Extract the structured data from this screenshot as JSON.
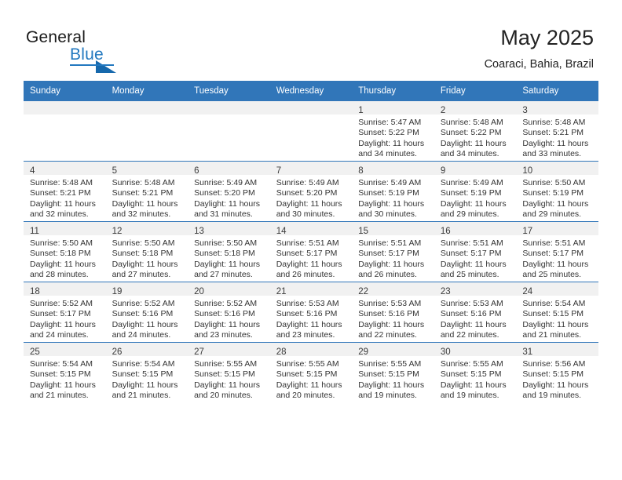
{
  "branding": {
    "name_part1": "General",
    "name_part2": "Blue",
    "accent_color": "#2278bf",
    "triangle_color": "#1668ac"
  },
  "header": {
    "title": "May 2025",
    "subtitle": "Coaraci, Bahia, Brazil"
  },
  "calendar": {
    "header_bg": "#3176b9",
    "daynum_bg": "#f1f1f1",
    "weekday_headers": [
      "Sunday",
      "Monday",
      "Tuesday",
      "Wednesday",
      "Thursday",
      "Friday",
      "Saturday"
    ],
    "weeks": [
      [
        {
          "day": "",
          "lines": []
        },
        {
          "day": "",
          "lines": []
        },
        {
          "day": "",
          "lines": []
        },
        {
          "day": "",
          "lines": []
        },
        {
          "day": "1",
          "lines": [
            "Sunrise: 5:47 AM",
            "Sunset: 5:22 PM",
            "Daylight: 11 hours",
            "and 34 minutes."
          ]
        },
        {
          "day": "2",
          "lines": [
            "Sunrise: 5:48 AM",
            "Sunset: 5:22 PM",
            "Daylight: 11 hours",
            "and 34 minutes."
          ]
        },
        {
          "day": "3",
          "lines": [
            "Sunrise: 5:48 AM",
            "Sunset: 5:21 PM",
            "Daylight: 11 hours",
            "and 33 minutes."
          ]
        }
      ],
      [
        {
          "day": "4",
          "lines": [
            "Sunrise: 5:48 AM",
            "Sunset: 5:21 PM",
            "Daylight: 11 hours",
            "and 32 minutes."
          ]
        },
        {
          "day": "5",
          "lines": [
            "Sunrise: 5:48 AM",
            "Sunset: 5:21 PM",
            "Daylight: 11 hours",
            "and 32 minutes."
          ]
        },
        {
          "day": "6",
          "lines": [
            "Sunrise: 5:49 AM",
            "Sunset: 5:20 PM",
            "Daylight: 11 hours",
            "and 31 minutes."
          ]
        },
        {
          "day": "7",
          "lines": [
            "Sunrise: 5:49 AM",
            "Sunset: 5:20 PM",
            "Daylight: 11 hours",
            "and 30 minutes."
          ]
        },
        {
          "day": "8",
          "lines": [
            "Sunrise: 5:49 AM",
            "Sunset: 5:19 PM",
            "Daylight: 11 hours",
            "and 30 minutes."
          ]
        },
        {
          "day": "9",
          "lines": [
            "Sunrise: 5:49 AM",
            "Sunset: 5:19 PM",
            "Daylight: 11 hours",
            "and 29 minutes."
          ]
        },
        {
          "day": "10",
          "lines": [
            "Sunrise: 5:50 AM",
            "Sunset: 5:19 PM",
            "Daylight: 11 hours",
            "and 29 minutes."
          ]
        }
      ],
      [
        {
          "day": "11",
          "lines": [
            "Sunrise: 5:50 AM",
            "Sunset: 5:18 PM",
            "Daylight: 11 hours",
            "and 28 minutes."
          ]
        },
        {
          "day": "12",
          "lines": [
            "Sunrise: 5:50 AM",
            "Sunset: 5:18 PM",
            "Daylight: 11 hours",
            "and 27 minutes."
          ]
        },
        {
          "day": "13",
          "lines": [
            "Sunrise: 5:50 AM",
            "Sunset: 5:18 PM",
            "Daylight: 11 hours",
            "and 27 minutes."
          ]
        },
        {
          "day": "14",
          "lines": [
            "Sunrise: 5:51 AM",
            "Sunset: 5:17 PM",
            "Daylight: 11 hours",
            "and 26 minutes."
          ]
        },
        {
          "day": "15",
          "lines": [
            "Sunrise: 5:51 AM",
            "Sunset: 5:17 PM",
            "Daylight: 11 hours",
            "and 26 minutes."
          ]
        },
        {
          "day": "16",
          "lines": [
            "Sunrise: 5:51 AM",
            "Sunset: 5:17 PM",
            "Daylight: 11 hours",
            "and 25 minutes."
          ]
        },
        {
          "day": "17",
          "lines": [
            "Sunrise: 5:51 AM",
            "Sunset: 5:17 PM",
            "Daylight: 11 hours",
            "and 25 minutes."
          ]
        }
      ],
      [
        {
          "day": "18",
          "lines": [
            "Sunrise: 5:52 AM",
            "Sunset: 5:17 PM",
            "Daylight: 11 hours",
            "and 24 minutes."
          ]
        },
        {
          "day": "19",
          "lines": [
            "Sunrise: 5:52 AM",
            "Sunset: 5:16 PM",
            "Daylight: 11 hours",
            "and 24 minutes."
          ]
        },
        {
          "day": "20",
          "lines": [
            "Sunrise: 5:52 AM",
            "Sunset: 5:16 PM",
            "Daylight: 11 hours",
            "and 23 minutes."
          ]
        },
        {
          "day": "21",
          "lines": [
            "Sunrise: 5:53 AM",
            "Sunset: 5:16 PM",
            "Daylight: 11 hours",
            "and 23 minutes."
          ]
        },
        {
          "day": "22",
          "lines": [
            "Sunrise: 5:53 AM",
            "Sunset: 5:16 PM",
            "Daylight: 11 hours",
            "and 22 minutes."
          ]
        },
        {
          "day": "23",
          "lines": [
            "Sunrise: 5:53 AM",
            "Sunset: 5:16 PM",
            "Daylight: 11 hours",
            "and 22 minutes."
          ]
        },
        {
          "day": "24",
          "lines": [
            "Sunrise: 5:54 AM",
            "Sunset: 5:15 PM",
            "Daylight: 11 hours",
            "and 21 minutes."
          ]
        }
      ],
      [
        {
          "day": "25",
          "lines": [
            "Sunrise: 5:54 AM",
            "Sunset: 5:15 PM",
            "Daylight: 11 hours",
            "and 21 minutes."
          ]
        },
        {
          "day": "26",
          "lines": [
            "Sunrise: 5:54 AM",
            "Sunset: 5:15 PM",
            "Daylight: 11 hours",
            "and 21 minutes."
          ]
        },
        {
          "day": "27",
          "lines": [
            "Sunrise: 5:55 AM",
            "Sunset: 5:15 PM",
            "Daylight: 11 hours",
            "and 20 minutes."
          ]
        },
        {
          "day": "28",
          "lines": [
            "Sunrise: 5:55 AM",
            "Sunset: 5:15 PM",
            "Daylight: 11 hours",
            "and 20 minutes."
          ]
        },
        {
          "day": "29",
          "lines": [
            "Sunrise: 5:55 AM",
            "Sunset: 5:15 PM",
            "Daylight: 11 hours",
            "and 19 minutes."
          ]
        },
        {
          "day": "30",
          "lines": [
            "Sunrise: 5:55 AM",
            "Sunset: 5:15 PM",
            "Daylight: 11 hours",
            "and 19 minutes."
          ]
        },
        {
          "day": "31",
          "lines": [
            "Sunrise: 5:56 AM",
            "Sunset: 5:15 PM",
            "Daylight: 11 hours",
            "and 19 minutes."
          ]
        }
      ]
    ]
  }
}
